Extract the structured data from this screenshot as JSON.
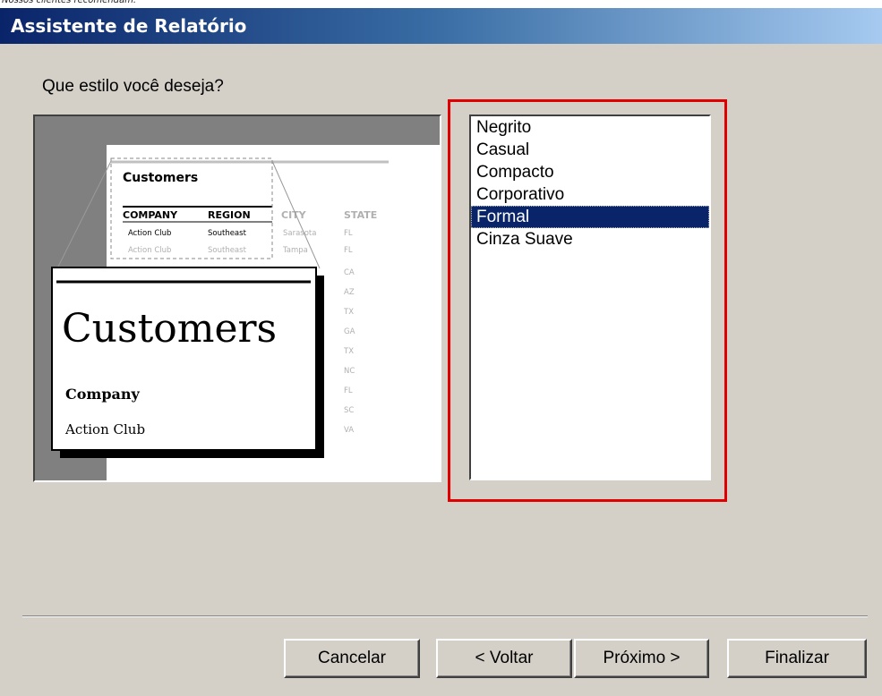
{
  "caption": "Nossos clientes recomendam.",
  "window": {
    "title": "Assistente de Relatório"
  },
  "question": "Que estilo você deseja?",
  "preview": {
    "back_title": "Customers",
    "columns": [
      "COMPANY",
      "REGION",
      "CITY",
      "STATE"
    ],
    "rows": [
      [
        "Action Club",
        "Southeast",
        "Sarasota",
        "FL"
      ],
      [
        "Action Club",
        "Southeast",
        "Tampa",
        "FL"
      ]
    ],
    "more_states": [
      "CA",
      "AZ",
      "TX",
      "GA",
      "TX",
      "NC",
      "FL",
      "SC",
      "VA"
    ],
    "zoom_title": "Customers",
    "zoom_header": "Company",
    "zoom_value": "Action Club"
  },
  "styles": {
    "items": [
      {
        "label": "Negrito",
        "selected": false
      },
      {
        "label": "Casual",
        "selected": false
      },
      {
        "label": "Compacto",
        "selected": false
      },
      {
        "label": "Corporativo",
        "selected": false
      },
      {
        "label": "Formal",
        "selected": true
      },
      {
        "label": "Cinza Suave",
        "selected": false
      }
    ]
  },
  "buttons": {
    "cancel": "Cancelar",
    "back": "< Voltar",
    "next": "Próximo >",
    "finish": "Finalizar"
  },
  "colors": {
    "highlight": "#e00000",
    "selection": "#0a246a",
    "dialog": "#d4d0c8"
  }
}
